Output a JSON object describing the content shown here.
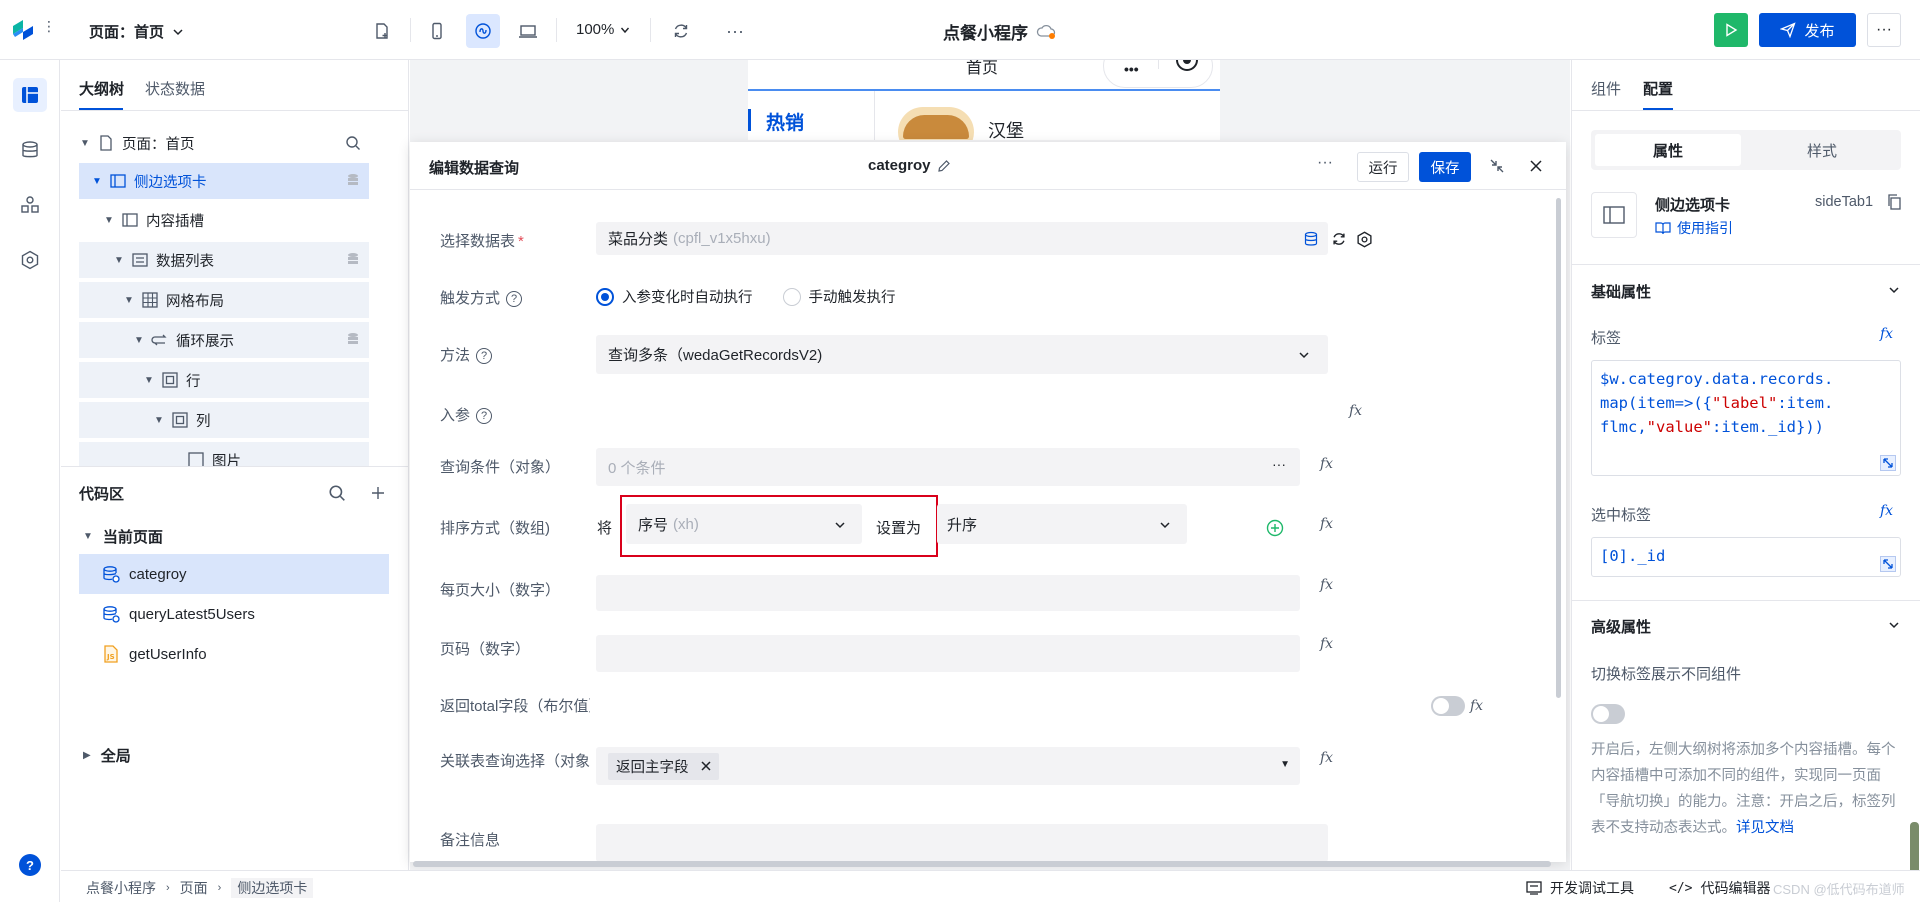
{
  "topbar": {
    "page_selector": "页面：首页",
    "zoom": "100%",
    "app_title": "点餐小程序",
    "publish_label": "发布"
  },
  "rail": {
    "help": "?"
  },
  "outline": {
    "tabs": [
      "大纲树",
      "状态数据"
    ],
    "tree": [
      {
        "label": "页面：首页"
      },
      {
        "label": "侧边选项卡"
      },
      {
        "label": "内容插槽"
      },
      {
        "label": "数据列表"
      },
      {
        "label": "网格布局"
      },
      {
        "label": "循环展示"
      },
      {
        "label": "行"
      },
      {
        "label": "列"
      },
      {
        "label": "图片"
      }
    ],
    "code_title": "代码区",
    "current_page": "当前页面",
    "code_items": [
      "categroy",
      "queryLatest5Users",
      "getUserInfo"
    ],
    "global": "全局"
  },
  "preview": {
    "home": "首页",
    "hot": "热销",
    "item": "汉堡"
  },
  "dialog": {
    "title": "编辑数据查询",
    "query_name": "categroy",
    "run_label": "运行",
    "save_label": "保存",
    "rows": {
      "datasource_label": "选择数据表",
      "datasource_value": "菜品分类",
      "datasource_id": "(cpfl_v1x5hxu)",
      "trigger_label": "触发方式",
      "trigger_auto": "入参变化时自动执行",
      "trigger_manual": "手动触发执行",
      "method_label": "方法",
      "method_value": "查询多条（wedaGetRecordsV2)",
      "params_label": "入参",
      "where_label": "查询条件（对象）",
      "where_placeholder": "0 个条件",
      "sort_label": "排序方式（数组)",
      "sort_prefix": "将",
      "sort_field": "序号",
      "sort_field_id": "(xh)",
      "sort_set_as": "设置为",
      "sort_order": "升序",
      "page_size_label": "每页大小（数字）",
      "page_no_label": "页码（数字）",
      "total_label": "返回total字段（布尔值）",
      "relation_label": "关联表查询选择（对象）",
      "relation_tag": "返回主字段",
      "remark_label": "备注信息"
    }
  },
  "rpanel": {
    "tabs": [
      "组件",
      "配置"
    ],
    "seg": [
      "属性",
      "样式"
    ],
    "comp_name": "侧边选项卡",
    "comp_id": "sideTab1",
    "guide": "使用指引",
    "basic_title": "基础属性",
    "label_title": "标签",
    "label_code_1": "$w.categroy.data.records.",
    "label_code_2a": "map(item=>({",
    "label_code_2b": "\"label\"",
    "label_code_2c": ":item.",
    "label_code_3a": "flmc,",
    "label_code_3b": "\"value\"",
    "label_code_3c": ":item._id}))",
    "selected_title": "选中标签",
    "selected_code": "[0]._id",
    "advanced_title": "高级属性",
    "switch_title": "切换标签展示不同组件",
    "desc": "开启后，左侧大纲树将添加多个内容插槽。每个内容插槽中可添加不同的组件，实现同一页面「导航切换」的能力。注意：开启之后，标签列表不支持动态表达式。",
    "doc_link": "详见文档"
  },
  "bottom": {
    "crumbs": [
      "点餐小程序",
      "页面",
      "侧边选项卡"
    ],
    "devtools": "开发调试工具",
    "code_editor": "代码编辑器",
    "watermark": "CSDN @低代码布道师"
  },
  "colors": {
    "primary": "#0052d9",
    "green": "#1fb86a",
    "highlight_box": "#d9001b"
  }
}
